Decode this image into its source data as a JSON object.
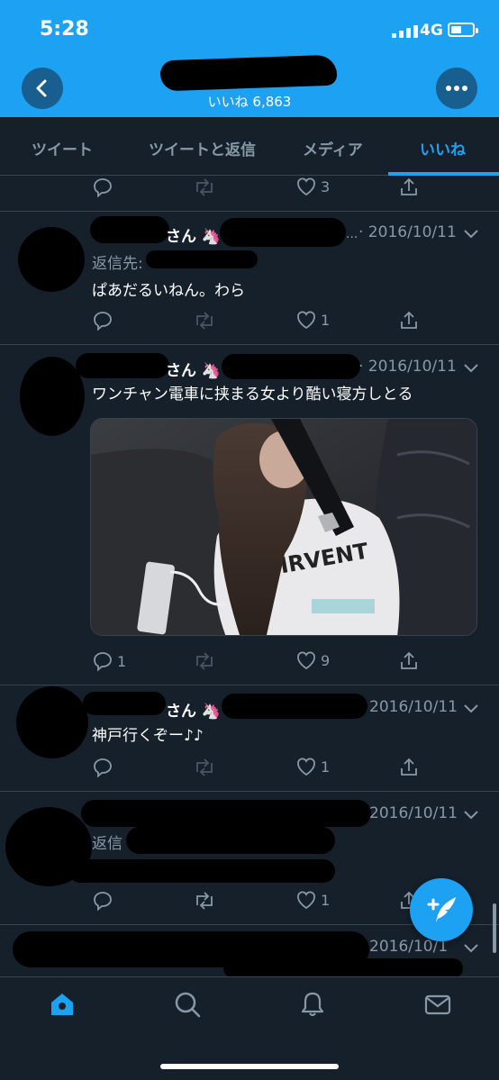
{
  "status_bar": {
    "time": "5:28",
    "network": "4G"
  },
  "header": {
    "subtitle": "いいね 6,863"
  },
  "tabs": [
    {
      "label": "ツイート",
      "active": false
    },
    {
      "label": "ツイートと返信",
      "active": false
    },
    {
      "label": "メディア",
      "active": false
    },
    {
      "label": "いいね",
      "active": true
    }
  ],
  "tweets": [
    {
      "likes": "3"
    },
    {
      "name_suffix": "さん 🦄",
      "dots": "...",
      "date": "· 2016/10/11",
      "reply_label": "返信先:",
      "text": "ぱあだるいねん。わら",
      "replies": "",
      "likes": "1"
    },
    {
      "name_suffix": "さん 🦄",
      "date": "· 2016/10/11",
      "text": "ワンチャン電車に挟まる女より酷い寝方しとる",
      "replies": "1",
      "likes": "9",
      "media_text": "DIRVENT"
    },
    {
      "name_suffix": "さん 🦄",
      "date": "2016/10/11",
      "text": "神戸行くぞー♪♪",
      "likes": "1"
    },
    {
      "date": "2016/10/11",
      "reply_label": "返信",
      "likes": "1"
    },
    {
      "date": "2016/10/1"
    }
  ],
  "icons": {
    "back": "chevron-left-icon",
    "more": "more-horizontal-icon",
    "compose": "compose-feather-icon",
    "nav": [
      "home-icon",
      "search-icon",
      "notifications-bell-icon",
      "messages-envelope-icon"
    ]
  },
  "colors": {
    "accent": "#1da1f2",
    "background": "#15202b",
    "muted": "#8899a6",
    "divider": "#38444d"
  }
}
